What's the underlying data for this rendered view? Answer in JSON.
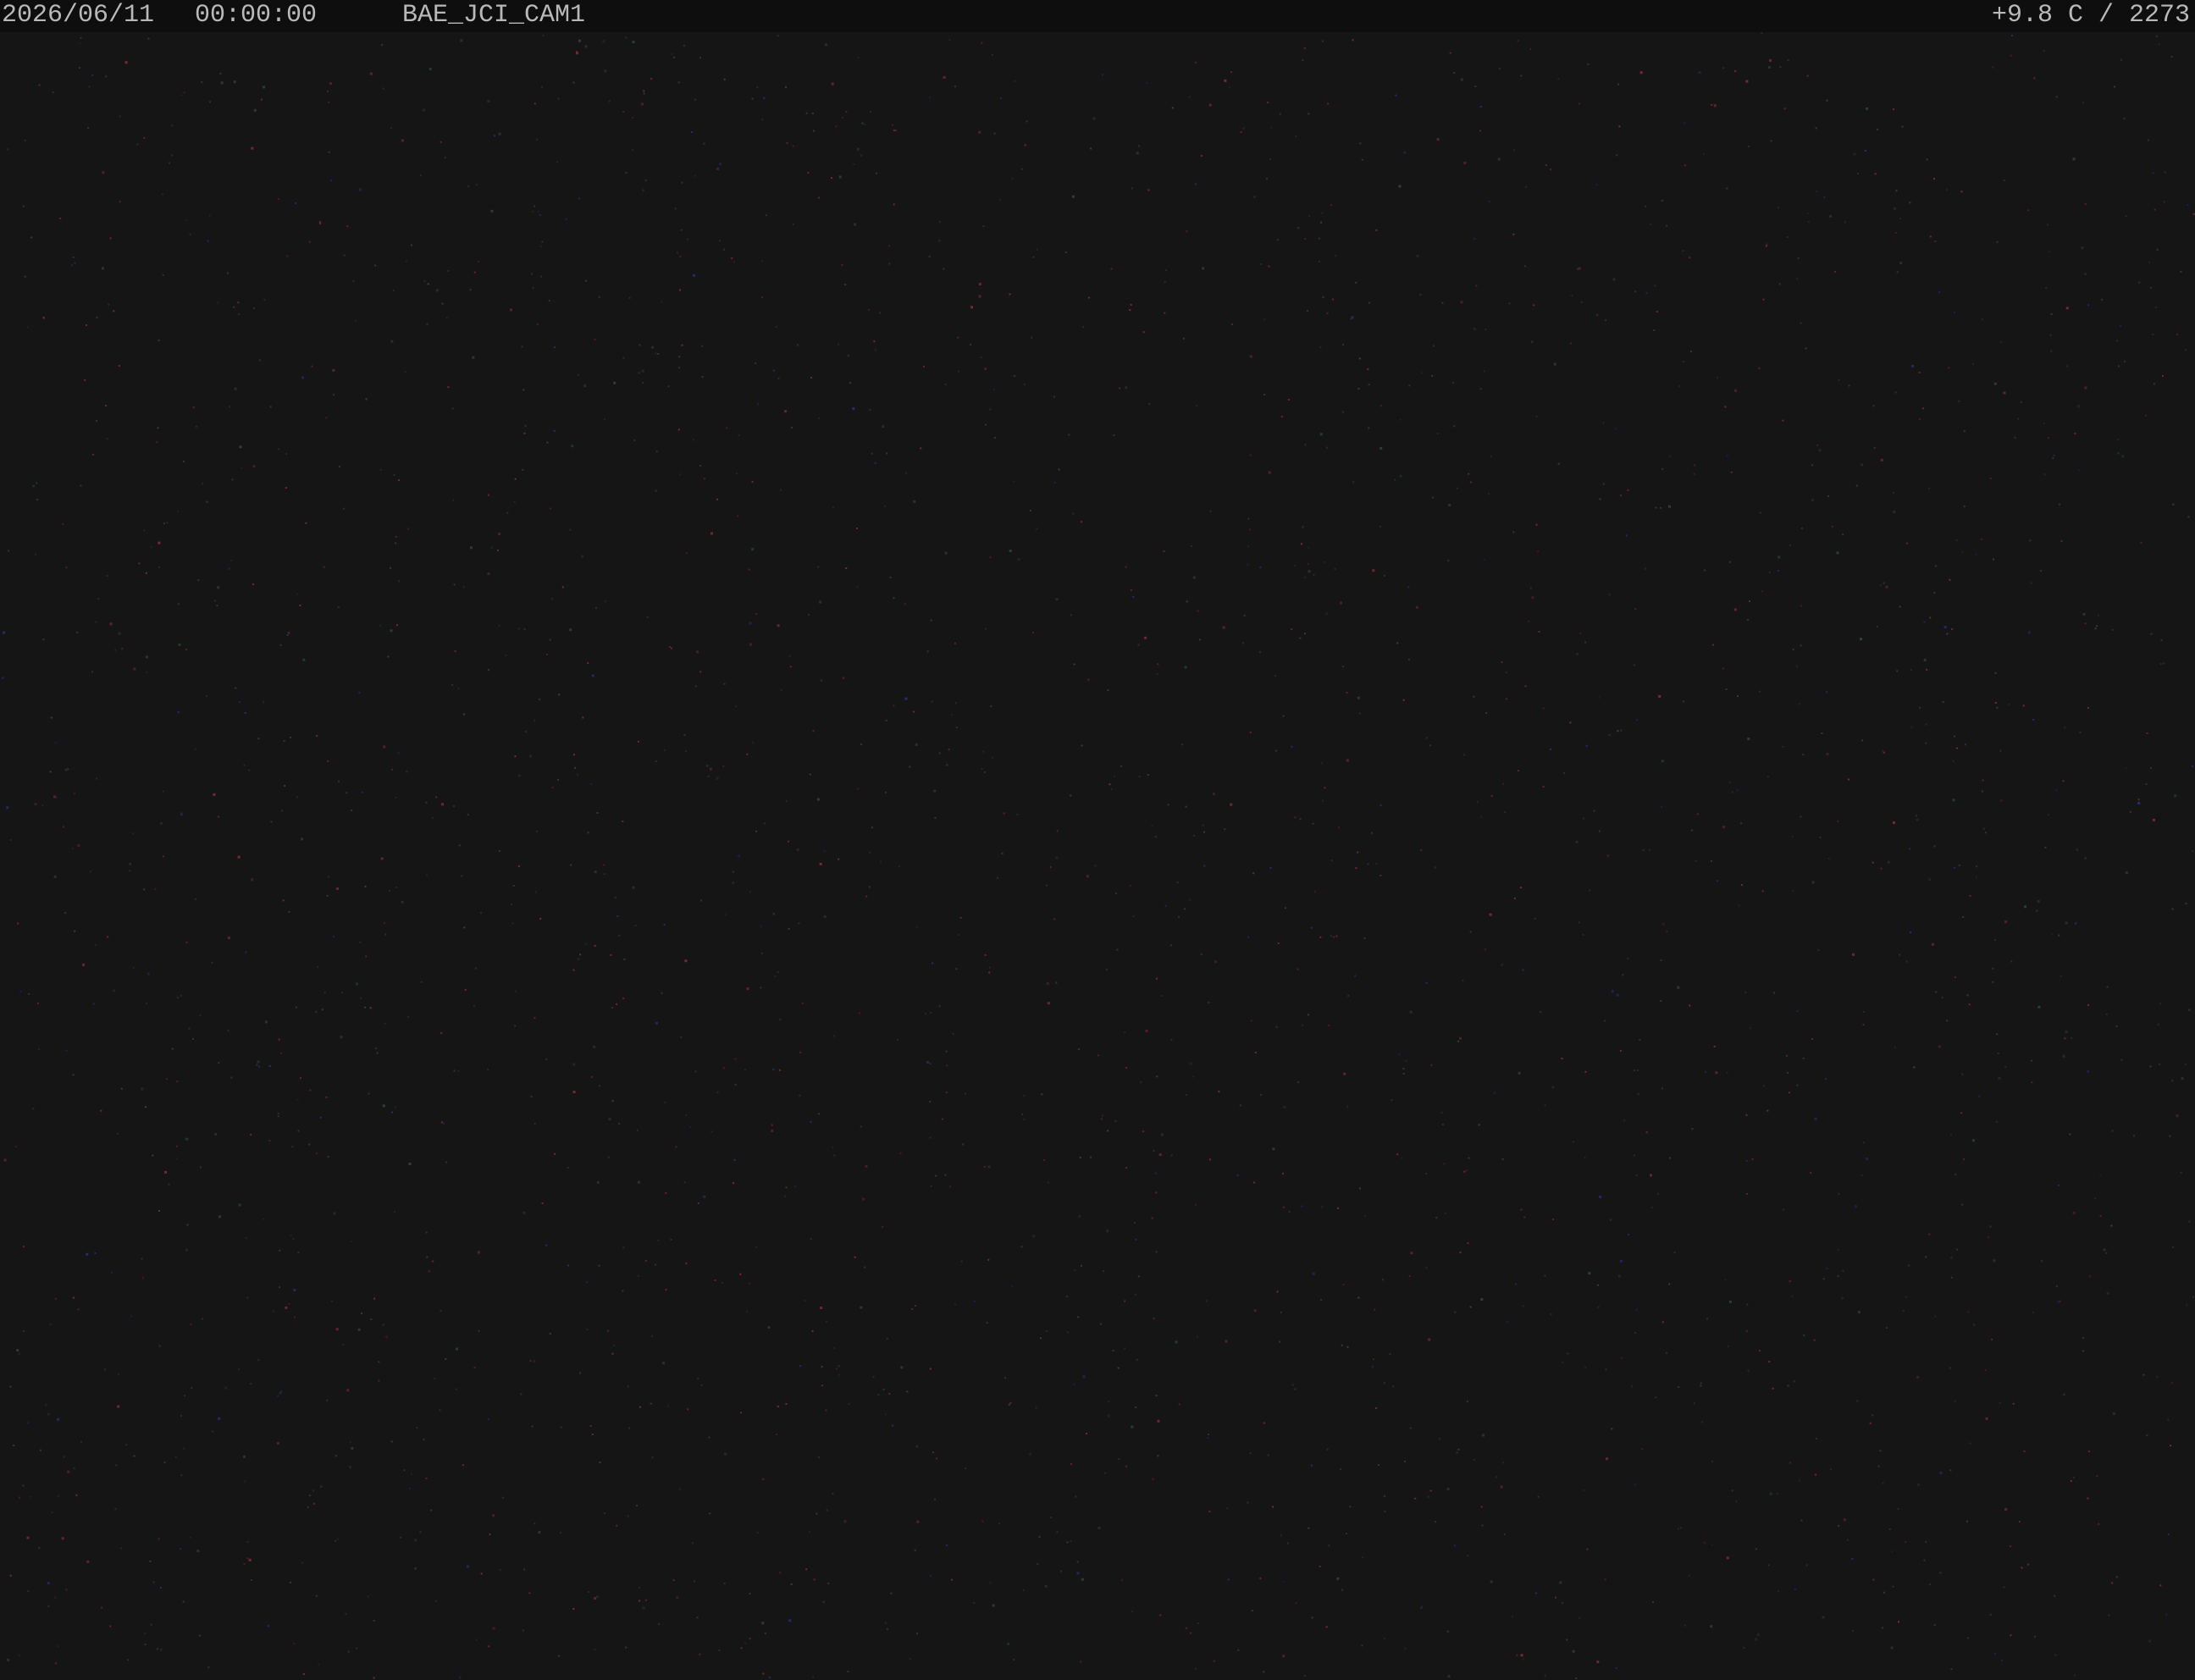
{
  "overlay": {
    "date": "2026/06/11",
    "time": "00:00:00",
    "camera_name": "BAE_JCI_CAM1",
    "temperature_reading": "+9.8 C / 2273"
  },
  "colors": {
    "background": "#151516",
    "overlay_bar": "#0e0e0f",
    "overlay_text": "#b9b9b9",
    "noise_red": "#8a2a3a",
    "noise_green": "#2e4a33",
    "noise_blue": "#2a2f80",
    "noise_gray": "#3a3a3c"
  }
}
